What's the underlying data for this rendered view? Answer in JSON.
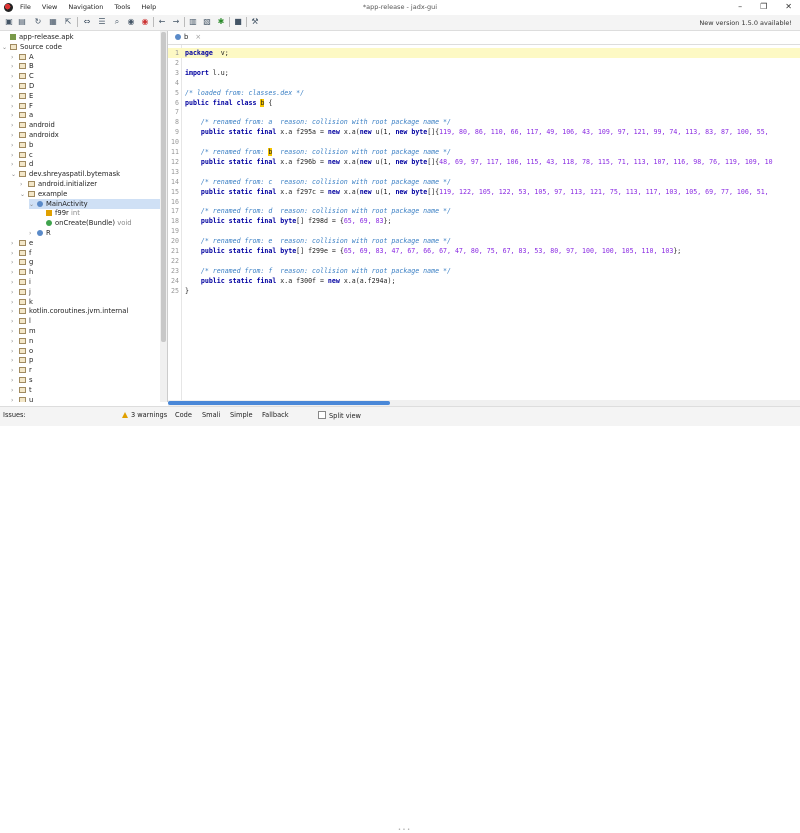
{
  "window": {
    "title": "*app-release - jadx-gui",
    "menu": [
      "File",
      "View",
      "Navigation",
      "Tools",
      "Help"
    ],
    "controls": [
      "–",
      "❐",
      "✕"
    ]
  },
  "toolbar": {
    "update_text": "New version 1.5.0 available!",
    "icons": [
      "open-icon",
      "save-icon",
      "refresh-icon",
      "save-all-icon",
      "export-icon",
      "sync-icon",
      "flatten-icon",
      "search-icon",
      "search-class-icon",
      "search-usage-icon",
      "back-icon",
      "forward-icon",
      "decompile-icon",
      "bookmark-icon",
      "log-icon",
      "debug-icon",
      "stop-icon",
      "settings-icon"
    ]
  },
  "tree": {
    "nodes": [
      {
        "label": "app-release.apk",
        "depth": 0,
        "arrow": "",
        "icon": "apk"
      },
      {
        "label": "Source code",
        "depth": 0,
        "arrow": "⌄",
        "icon": "pkg"
      },
      {
        "label": "A",
        "depth": 1,
        "arrow": "›",
        "icon": "pkg"
      },
      {
        "label": "B",
        "depth": 1,
        "arrow": "›",
        "icon": "pkg"
      },
      {
        "label": "C",
        "depth": 1,
        "arrow": "›",
        "icon": "pkg"
      },
      {
        "label": "D",
        "depth": 1,
        "arrow": "›",
        "icon": "pkg"
      },
      {
        "label": "E",
        "depth": 1,
        "arrow": "›",
        "icon": "pkg"
      },
      {
        "label": "F",
        "depth": 1,
        "arrow": "›",
        "icon": "pkg"
      },
      {
        "label": "a",
        "depth": 1,
        "arrow": "›",
        "icon": "pkg"
      },
      {
        "label": "android",
        "depth": 1,
        "arrow": "›",
        "icon": "pkg"
      },
      {
        "label": "androidx",
        "depth": 1,
        "arrow": "›",
        "icon": "pkg"
      },
      {
        "label": "b",
        "depth": 1,
        "arrow": "›",
        "icon": "pkg"
      },
      {
        "label": "c",
        "depth": 1,
        "arrow": "›",
        "icon": "pkg"
      },
      {
        "label": "d",
        "depth": 1,
        "arrow": "›",
        "icon": "pkg"
      },
      {
        "label": "dev.shreyaspatil.bytemask",
        "depth": 1,
        "arrow": "⌄",
        "icon": "pkg"
      },
      {
        "label": "android.initializer",
        "depth": 2,
        "arrow": "›",
        "icon": "pkg"
      },
      {
        "label": "example",
        "depth": 2,
        "arrow": "⌄",
        "icon": "pkg"
      },
      {
        "label": "MainActivity",
        "depth": 3,
        "arrow": "⌄",
        "icon": "cls",
        "selected": true
      },
      {
        "label": "f99r",
        "suffix": "int",
        "depth": 4,
        "arrow": "",
        "icon": "fld"
      },
      {
        "label": "onCreate(Bundle)",
        "suffix": "void",
        "depth": 4,
        "arrow": "",
        "icon": "mth"
      },
      {
        "label": "R",
        "depth": 3,
        "arrow": "›",
        "icon": "cls"
      },
      {
        "label": "e",
        "depth": 1,
        "arrow": "›",
        "icon": "pkg"
      },
      {
        "label": "f",
        "depth": 1,
        "arrow": "›",
        "icon": "pkg"
      },
      {
        "label": "g",
        "depth": 1,
        "arrow": "›",
        "icon": "pkg"
      },
      {
        "label": "h",
        "depth": 1,
        "arrow": "›",
        "icon": "pkg"
      },
      {
        "label": "i",
        "depth": 1,
        "arrow": "›",
        "icon": "pkg"
      },
      {
        "label": "j",
        "depth": 1,
        "arrow": "›",
        "icon": "pkg"
      },
      {
        "label": "k",
        "depth": 1,
        "arrow": "›",
        "icon": "pkg"
      },
      {
        "label": "kotlin.coroutines.jvm.internal",
        "depth": 1,
        "arrow": "›",
        "icon": "pkg"
      },
      {
        "label": "l",
        "depth": 1,
        "arrow": "›",
        "icon": "pkg"
      },
      {
        "label": "m",
        "depth": 1,
        "arrow": "›",
        "icon": "pkg"
      },
      {
        "label": "n",
        "depth": 1,
        "arrow": "›",
        "icon": "pkg"
      },
      {
        "label": "o",
        "depth": 1,
        "arrow": "›",
        "icon": "pkg"
      },
      {
        "label": "p",
        "depth": 1,
        "arrow": "›",
        "icon": "pkg"
      },
      {
        "label": "r",
        "depth": 1,
        "arrow": "›",
        "icon": "pkg"
      },
      {
        "label": "s",
        "depth": 1,
        "arrow": "›",
        "icon": "pkg"
      },
      {
        "label": "t",
        "depth": 1,
        "arrow": "›",
        "icon": "pkg"
      },
      {
        "label": "u",
        "depth": 1,
        "arrow": "›",
        "icon": "pkg"
      }
    ]
  },
  "editor": {
    "tab_label": "b",
    "tab_close": "×",
    "lines": [
      {
        "n": "1",
        "hl": true,
        "parts": [
          [
            "kw",
            "package"
          ],
          [
            "",
            "  v;"
          ]
        ]
      },
      {
        "n": "2",
        "parts": []
      },
      {
        "n": "3",
        "parts": [
          [
            "kw",
            "import"
          ],
          [
            "",
            " l.u;"
          ]
        ]
      },
      {
        "n": "4",
        "parts": []
      },
      {
        "n": "5",
        "parts": [
          [
            "cm",
            "/* loaded from: classes.dex */"
          ]
        ]
      },
      {
        "n": "6",
        "parts": [
          [
            "kw",
            "public final class "
          ],
          [
            "mk",
            "b"
          ],
          [
            "",
            " {"
          ]
        ]
      },
      {
        "n": "7",
        "parts": []
      },
      {
        "n": "8",
        "parts": [
          [
            "cm",
            "    /* renamed from: a  reason: collision with root package name */"
          ]
        ]
      },
      {
        "n": "9",
        "parts": [
          [
            "kw",
            "    public static final "
          ],
          [
            "",
            "x.a f295a = "
          ],
          [
            "kw",
            "new"
          ],
          [
            "",
            " x.a("
          ],
          [
            "kw",
            "new"
          ],
          [
            "",
            " u(1, "
          ],
          [
            "kw",
            "new"
          ],
          [
            " ",
            "byte"
          ],
          [
            "",
            "[]{"
          ],
          [
            "num",
            "119, 80, 86, 110, 66, 117, 49, 106, 43, 109, 97, 121, 99, 74, 113, 83, 87, 100, 55,"
          ]
        ]
      },
      {
        "n": "10",
        "parts": []
      },
      {
        "n": "11",
        "parts": [
          [
            "cm",
            "    /* renamed from: "
          ],
          [
            "mk",
            "b"
          ],
          [
            "cm",
            "  reason: collision with root package name */"
          ]
        ]
      },
      {
        "n": "12",
        "parts": [
          [
            "kw",
            "    public static final "
          ],
          [
            "",
            "x.a f296b = "
          ],
          [
            "kw",
            "new"
          ],
          [
            "",
            " x.a("
          ],
          [
            "kw",
            "new"
          ],
          [
            "",
            " u(1, "
          ],
          [
            "kw",
            "new"
          ],
          [
            " ",
            "byte"
          ],
          [
            "",
            "[]{"
          ],
          [
            "num",
            "48, 69, 97, 117, 106, 115, 43, 118, 78, 115, 71, 113, 107, 116, 98, 76, 119, 109, 10"
          ]
        ]
      },
      {
        "n": "13",
        "parts": []
      },
      {
        "n": "14",
        "parts": [
          [
            "cm",
            "    /* renamed from: c  reason: collision with root package name */"
          ]
        ]
      },
      {
        "n": "15",
        "parts": [
          [
            "kw",
            "    public static final "
          ],
          [
            "",
            "x.a f297c = "
          ],
          [
            "kw",
            "new"
          ],
          [
            "",
            " x.a("
          ],
          [
            "kw",
            "new"
          ],
          [
            "",
            " u(1, "
          ],
          [
            "kw",
            "new"
          ],
          [
            " ",
            "byte"
          ],
          [
            "",
            "[]{"
          ],
          [
            "num",
            "119, 122, 105, 122, 53, 105, 97, 113, 121, 75, 113, 117, 103, 105, 69, 77, 106, 51,"
          ]
        ]
      },
      {
        "n": "16",
        "parts": []
      },
      {
        "n": "17",
        "parts": [
          [
            "cm",
            "    /* renamed from: d  reason: collision with root package name */"
          ]
        ]
      },
      {
        "n": "18",
        "parts": [
          [
            "kw",
            "    public static final "
          ],
          [
            "kw",
            "byte"
          ],
          [
            "",
            "[] f298d = {"
          ],
          [
            "num",
            "65, 69, 83"
          ],
          [
            "",
            "};"
          ]
        ]
      },
      {
        "n": "19",
        "parts": []
      },
      {
        "n": "20",
        "parts": [
          [
            "cm",
            "    /* renamed from: e  reason: collision with root package name */"
          ]
        ]
      },
      {
        "n": "21",
        "parts": [
          [
            "kw",
            "    public static final "
          ],
          [
            "kw",
            "byte"
          ],
          [
            "",
            "[] f299e = {"
          ],
          [
            "num",
            "65, 69, 83, 47, 67, 66, 67, 47, 80, 75, 67, 83, 53, 80, 97, 100, 100, 105, 110, 103"
          ],
          [
            "",
            "};"
          ]
        ]
      },
      {
        "n": "22",
        "parts": []
      },
      {
        "n": "23",
        "parts": [
          [
            "cm",
            "    /* renamed from: f  reason: collision with root package name */"
          ]
        ]
      },
      {
        "n": "24",
        "parts": [
          [
            "kw",
            "    public static final "
          ],
          [
            "",
            "x.a f300f = "
          ],
          [
            "kw",
            "new"
          ],
          [
            "",
            " x.a(a.f294a);"
          ]
        ]
      },
      {
        "n": "25",
        "parts": [
          [
            "",
            "}"
          ]
        ]
      }
    ]
  },
  "status": {
    "issues_label": "Issues:",
    "warnings": "3 warnings",
    "views": [
      "Code",
      "Smali",
      "Simple",
      "Fallback"
    ],
    "split_view": "Split view"
  }
}
